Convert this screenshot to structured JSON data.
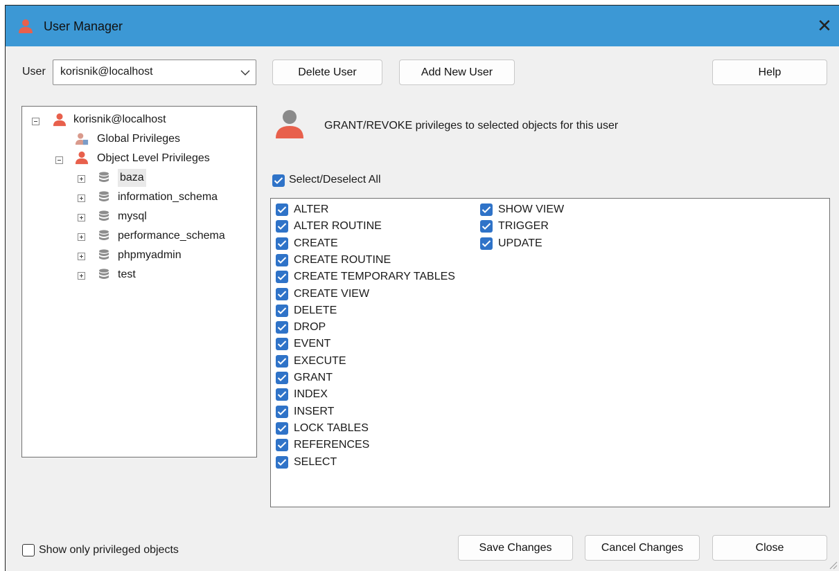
{
  "window": {
    "title": "User Manager",
    "close_glyph": "✕",
    "title_icon": "user-icon"
  },
  "colors": {
    "titlebar": "#3c98d5",
    "checkbox": "#2f73c8",
    "user_icon": "#e8604c"
  },
  "user": {
    "label": "User",
    "selected": "korisnik@localhost"
  },
  "buttons": {
    "delete_user": "Delete User",
    "add_new_user": "Add New User",
    "help": "Help",
    "save_changes": "Save Changes",
    "cancel_changes": "Cancel Changes",
    "close": "Close"
  },
  "tree": {
    "root": "korisnik@localhost",
    "global": "Global Privileges",
    "object_level": "Object Level Privileges",
    "databases": [
      "baza",
      "information_schema",
      "mysql",
      "performance_schema",
      "phpmyadmin",
      "test"
    ],
    "selected_database": "baza"
  },
  "grant_text": "GRANT/REVOKE privileges to selected objects for this user",
  "select_all": {
    "label": "Select/Deselect All",
    "checked": true
  },
  "privileges": [
    {
      "label": "ALTER",
      "checked": true
    },
    {
      "label": "ALTER ROUTINE",
      "checked": true
    },
    {
      "label": "CREATE",
      "checked": true
    },
    {
      "label": "CREATE ROUTINE",
      "checked": true
    },
    {
      "label": "CREATE TEMPORARY TABLES",
      "checked": true
    },
    {
      "label": "CREATE VIEW",
      "checked": true
    },
    {
      "label": "DELETE",
      "checked": true
    },
    {
      "label": "DROP",
      "checked": true
    },
    {
      "label": "EVENT",
      "checked": true
    },
    {
      "label": "EXECUTE",
      "checked": true
    },
    {
      "label": "GRANT",
      "checked": true
    },
    {
      "label": "INDEX",
      "checked": true
    },
    {
      "label": "INSERT",
      "checked": true
    },
    {
      "label": "LOCK TABLES",
      "checked": true
    },
    {
      "label": "REFERENCES",
      "checked": true
    },
    {
      "label": "SELECT",
      "checked": true
    },
    {
      "label": "SHOW VIEW",
      "checked": true
    },
    {
      "label": "TRIGGER",
      "checked": true
    },
    {
      "label": "UPDATE",
      "checked": true
    }
  ],
  "show_only": {
    "label": "Show only privileged objects",
    "checked": false
  }
}
